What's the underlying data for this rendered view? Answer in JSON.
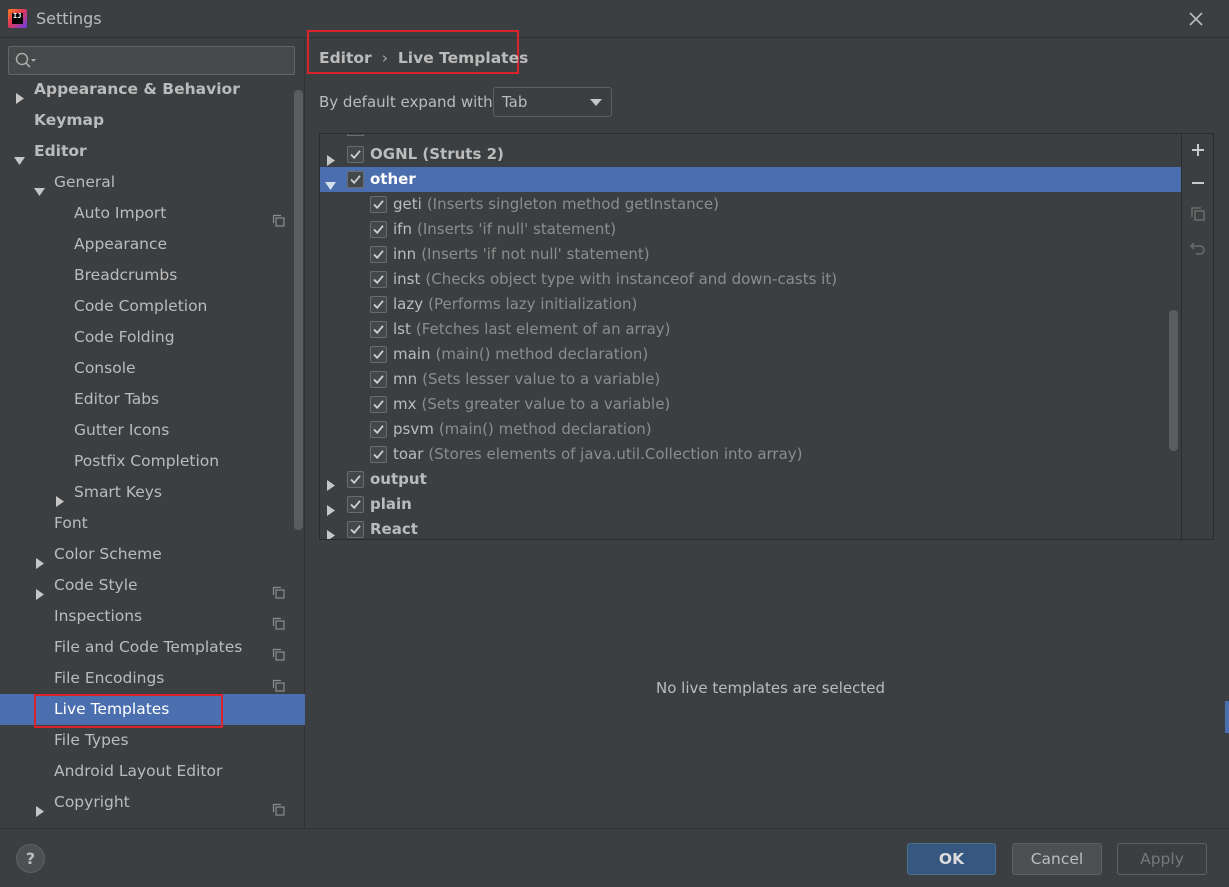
{
  "window": {
    "title": "Settings",
    "app_icon_text": "IJ"
  },
  "search": {
    "placeholder": "",
    "value": ""
  },
  "sidebar": {
    "items": [
      {
        "label": "Appearance & Behavior",
        "bold": true,
        "level": 0,
        "arrow": "right"
      },
      {
        "label": "Keymap",
        "bold": true,
        "level": 0,
        "arrow": "none"
      },
      {
        "label": "Editor",
        "bold": true,
        "level": 0,
        "arrow": "down"
      },
      {
        "label": "General",
        "bold": false,
        "level": 1,
        "arrow": "down"
      },
      {
        "label": "Auto Import",
        "bold": false,
        "level": 2,
        "arrow": "none",
        "copy_icon": true
      },
      {
        "label": "Appearance",
        "bold": false,
        "level": 2,
        "arrow": "none"
      },
      {
        "label": "Breadcrumbs",
        "bold": false,
        "level": 2,
        "arrow": "none"
      },
      {
        "label": "Code Completion",
        "bold": false,
        "level": 2,
        "arrow": "none"
      },
      {
        "label": "Code Folding",
        "bold": false,
        "level": 2,
        "arrow": "none"
      },
      {
        "label": "Console",
        "bold": false,
        "level": 2,
        "arrow": "none"
      },
      {
        "label": "Editor Tabs",
        "bold": false,
        "level": 2,
        "arrow": "none"
      },
      {
        "label": "Gutter Icons",
        "bold": false,
        "level": 2,
        "arrow": "none"
      },
      {
        "label": "Postfix Completion",
        "bold": false,
        "level": 2,
        "arrow": "none"
      },
      {
        "label": "Smart Keys",
        "bold": false,
        "level": 2,
        "arrow": "right"
      },
      {
        "label": "Font",
        "bold": false,
        "level": 1,
        "arrow": "none"
      },
      {
        "label": "Color Scheme",
        "bold": false,
        "level": 1,
        "arrow": "right"
      },
      {
        "label": "Code Style",
        "bold": false,
        "level": 1,
        "arrow": "right",
        "copy_icon": true
      },
      {
        "label": "Inspections",
        "bold": false,
        "level": 1,
        "arrow": "none",
        "copy_icon": true
      },
      {
        "label": "File and Code Templates",
        "bold": false,
        "level": 1,
        "arrow": "none",
        "copy_icon": true
      },
      {
        "label": "File Encodings",
        "bold": false,
        "level": 1,
        "arrow": "none",
        "copy_icon": true
      },
      {
        "label": "Live Templates",
        "bold": false,
        "level": 1,
        "arrow": "none",
        "selected": true
      },
      {
        "label": "File Types",
        "bold": false,
        "level": 1,
        "arrow": "none"
      },
      {
        "label": "Android Layout Editor",
        "bold": false,
        "level": 1,
        "arrow": "none"
      },
      {
        "label": "Copyright",
        "bold": false,
        "level": 1,
        "arrow": "right",
        "copy_icon": true
      }
    ]
  },
  "breadcrumb": {
    "parent": "Editor",
    "separator": "›",
    "current": "Live Templates"
  },
  "expand": {
    "label": "By default expand with",
    "value": "Tab"
  },
  "templates": {
    "rows": [
      {
        "name": "OGNL (Struts 2)",
        "desc": "",
        "group": true,
        "arrow": "right",
        "checked": true
      },
      {
        "name": "other",
        "desc": "",
        "group": true,
        "arrow": "down",
        "checked": true,
        "selected": true
      },
      {
        "name": "geti",
        "desc": "(Inserts singleton method getInstance)",
        "group": false,
        "checked": true
      },
      {
        "name": "ifn",
        "desc": "(Inserts 'if null' statement)",
        "group": false,
        "checked": true
      },
      {
        "name": "inn",
        "desc": "(Inserts 'if not null' statement)",
        "group": false,
        "checked": true
      },
      {
        "name": "inst",
        "desc": "(Checks object type with instanceof and down-casts it)",
        "group": false,
        "checked": true
      },
      {
        "name": "lazy",
        "desc": "(Performs lazy initialization)",
        "group": false,
        "checked": true
      },
      {
        "name": "lst",
        "desc": "(Fetches last element of an array)",
        "group": false,
        "checked": true
      },
      {
        "name": "main",
        "desc": "(main() method declaration)",
        "group": false,
        "checked": true
      },
      {
        "name": "mn",
        "desc": "(Sets lesser value to a variable)",
        "group": false,
        "checked": true
      },
      {
        "name": "mx",
        "desc": "(Sets greater value to a variable)",
        "group": false,
        "checked": true
      },
      {
        "name": "psvm",
        "desc": "(main() method declaration)",
        "group": false,
        "checked": true
      },
      {
        "name": "toar",
        "desc": "(Stores elements of java.util.Collection into array)",
        "group": false,
        "checked": true
      },
      {
        "name": "output",
        "desc": "",
        "group": true,
        "arrow": "right",
        "checked": true
      },
      {
        "name": "plain",
        "desc": "",
        "group": true,
        "arrow": "right",
        "checked": true
      },
      {
        "name": "React",
        "desc": "",
        "group": true,
        "arrow": "right",
        "checked": true
      }
    ]
  },
  "tools": {
    "add": "plus-icon",
    "remove": "minus-icon",
    "copy": "copy-icon",
    "restore": "undo-icon"
  },
  "empty_message": "No live templates are selected",
  "footer": {
    "help": "?",
    "ok": "OK",
    "cancel": "Cancel",
    "apply": "Apply"
  },
  "colors": {
    "selection": "#4b6eaf",
    "highlight_box": "#d9232d",
    "background": "#3c3f41"
  }
}
